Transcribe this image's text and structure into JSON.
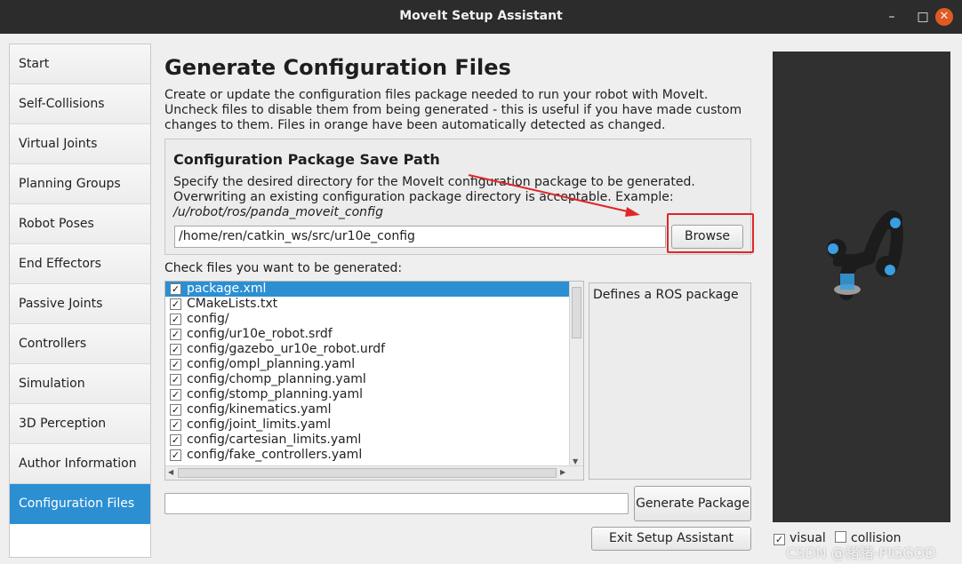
{
  "window": {
    "title": "MoveIt Setup Assistant",
    "minimize_glyph": "–",
    "maximize_glyph": "□",
    "close_glyph": "✕"
  },
  "sidebar": {
    "items": [
      {
        "label": "Start"
      },
      {
        "label": "Self-Collisions"
      },
      {
        "label": "Virtual Joints"
      },
      {
        "label": "Planning Groups"
      },
      {
        "label": "Robot Poses"
      },
      {
        "label": "End Effectors"
      },
      {
        "label": "Passive Joints"
      },
      {
        "label": "Controllers"
      },
      {
        "label": "Simulation"
      },
      {
        "label": "3D Perception"
      },
      {
        "label": "Author Information"
      },
      {
        "label": "Configuration Files"
      }
    ],
    "active_index": 11
  },
  "main": {
    "title": "Generate Configuration Files",
    "description": "Create or update the configuration files package needed to run your robot with MoveIt. Uncheck files to disable them from being generated - this is useful if you have made custom changes to them. Files in orange have been automatically detected as changed.",
    "save_path": {
      "heading": "Configuration Package Save Path",
      "description": "Specify the desired directory for the MoveIt configuration package to be generated. Overwriting an existing configuration package directory is acceptable. Example: ",
      "example": "/u/robot/ros/panda_moveit_config",
      "value": "/home/ren/catkin_ws/src/ur10e_config",
      "browse_label": "Browse"
    },
    "files_label": "Check files you want to be generated:",
    "files": [
      {
        "name": "package.xml",
        "checked": true
      },
      {
        "name": "CMakeLists.txt",
        "checked": true
      },
      {
        "name": "config/",
        "checked": true
      },
      {
        "name": "config/ur10e_robot.srdf",
        "checked": true
      },
      {
        "name": "config/gazebo_ur10e_robot.urdf",
        "checked": true
      },
      {
        "name": "config/ompl_planning.yaml",
        "checked": true
      },
      {
        "name": "config/chomp_planning.yaml",
        "checked": true
      },
      {
        "name": "config/stomp_planning.yaml",
        "checked": true
      },
      {
        "name": "config/kinematics.yaml",
        "checked": true
      },
      {
        "name": "config/joint_limits.yaml",
        "checked": true
      },
      {
        "name": "config/cartesian_limits.yaml",
        "checked": true
      },
      {
        "name": "config/fake_controllers.yaml",
        "checked": true
      }
    ],
    "selected_file_index": 0,
    "file_description": "Defines a ROS package",
    "status_value": "",
    "generate_label": "Generate Package",
    "exit_label": "Exit Setup Assistant"
  },
  "viewer": {
    "visual_label": "visual",
    "visual_checked": true,
    "collision_label": "collision",
    "collision_checked": false
  },
  "watermark": "CSDN @猪猪-PIGGOD",
  "colors": {
    "accent": "#2c8fd2",
    "highlight": "#e0262a",
    "titlebar": "#2c2c2c"
  }
}
